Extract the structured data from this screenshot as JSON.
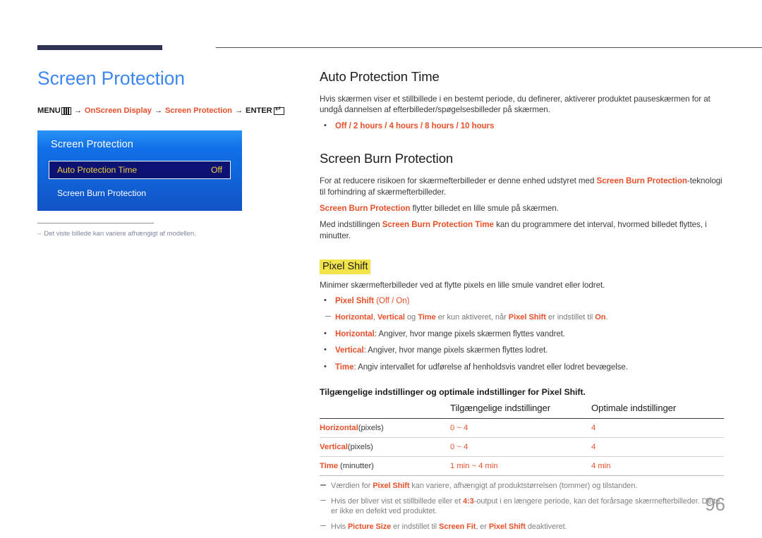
{
  "page": {
    "number": "96",
    "language": "da"
  },
  "left": {
    "title": "Screen Protection",
    "breadcrumb": {
      "menu_label": "MENU",
      "menu_icon": "menu-bars-icon",
      "arrow": "→",
      "item1": "OnScreen Display",
      "item2": "Screen Protection",
      "enter_label": "ENTER",
      "enter_icon": "enter-return-icon"
    },
    "osd": {
      "title": "Screen Protection",
      "rows": [
        {
          "label": "Auto Protection Time",
          "value": "Off",
          "selected": true
        },
        {
          "label": "Screen Burn Protection",
          "value": "",
          "selected": false
        }
      ]
    },
    "note": {
      "dash": "–",
      "text": "Det viste billede kan variere afhængigt af modellen."
    }
  },
  "right": {
    "section1": {
      "heading": "Auto Protection Time",
      "paragraph": "Hvis skærmen viser et stillbillede i en bestemt periode, du definerer, aktiverer produktet pauseskærmen for at undgå dannelsen af efterbilleder/spøgelsesbilleder på skærmen.",
      "options": "Off / 2 hours / 4 hours / 8 hours / 10 hours"
    },
    "section2": {
      "heading": "Screen Burn Protection",
      "p1_a": "For at reducere risikoen for skærmefterbilleder er denne enhed udstyret med ",
      "p1_term": "Screen Burn Protection",
      "p1_b": "-teknologi til forhindring af skærmefterbilleder.",
      "p2_term": "Screen Burn Protection",
      "p2_b": " flytter billedet en lille smule på skærmen.",
      "p3_a": "Med indstillingen ",
      "p3_term": "Screen Burn Protection Time",
      "p3_b": " kan du programmere det interval, hvormed billedet flyttes, i minutter."
    },
    "pixel_shift": {
      "heading": "Pixel Shift",
      "intro": "Minimer skærmefterbilleder ved at flytte pixels en lille smule vandret eller lodret.",
      "bullet1_term": "Pixel Shift",
      "bullet1_rest": " (Off / On)",
      "subnote": {
        "t1": "Horizontal",
        "sep1": ", ",
        "t2": "Vertical",
        "sep2": " og ",
        "t3": "Time",
        "mid": " er kun aktiveret, når ",
        "t4": "Pixel Shift",
        "mid2": " er indstillet til ",
        "t5": "On",
        "end": "."
      },
      "bullets": [
        {
          "term": "Horizontal",
          "rest": ": Angiver, hvor mange pixels skærmen flyttes vandret."
        },
        {
          "term": "Vertical",
          "rest": ": Angiver, hvor mange pixels skærmen flyttes lodret."
        },
        {
          "term": "Time",
          "rest": ": Angiv intervallet for udførelse af henholdsvis vandret eller lodret bevægelse."
        }
      ]
    },
    "table": {
      "caption": "Tilgængelige indstillinger og optimale indstillinger for Pixel Shift.",
      "headers": [
        "",
        "Tilgængelige indstillinger",
        "Optimale indstillinger"
      ],
      "rows": [
        {
          "term": "Horizontal",
          "unit": "(pixels)",
          "available": "0 ~ 4",
          "optimal": "4"
        },
        {
          "term": "Vertical",
          "unit": "(pixels)",
          "available": "0 ~ 4",
          "optimal": "4"
        },
        {
          "term": "Time",
          "unit": " (minutter)",
          "available": "1 min ~ 4 min",
          "optimal": "4 min"
        }
      ]
    },
    "footnotes": {
      "f1_a": "Værdien for ",
      "f1_term": "Pixel Shift",
      "f1_b": " kan variere, afhængigt af produktstørrelsen (tommer) og tilstanden.",
      "f2_a": "Hvis der bliver vist et stillbillede eller et ",
      "f2_term": "4:3",
      "f2_b": "-output i en længere periode, kan det forårsage skærmefterbilleder. Dette er ikke en defekt ved produktet.",
      "f3_a": "Hvis ",
      "f3_t1": "Picture Size",
      "f3_b": " er indstillet til ",
      "f3_t2": "Screen Fit",
      "f3_c": ", er ",
      "f3_t3": "Pixel Shift",
      "f3_d": " deaktiveret."
    }
  },
  "colors": {
    "accent_blue": "#3d87f0",
    "accent_red": "#e8502a",
    "highlight_yellow": "#f2e34a",
    "osd_blue": "#1170e8",
    "osd_selected": "#0b1272",
    "osd_selected_text": "#f3cf3c",
    "rule_navy": "#2e3354"
  }
}
